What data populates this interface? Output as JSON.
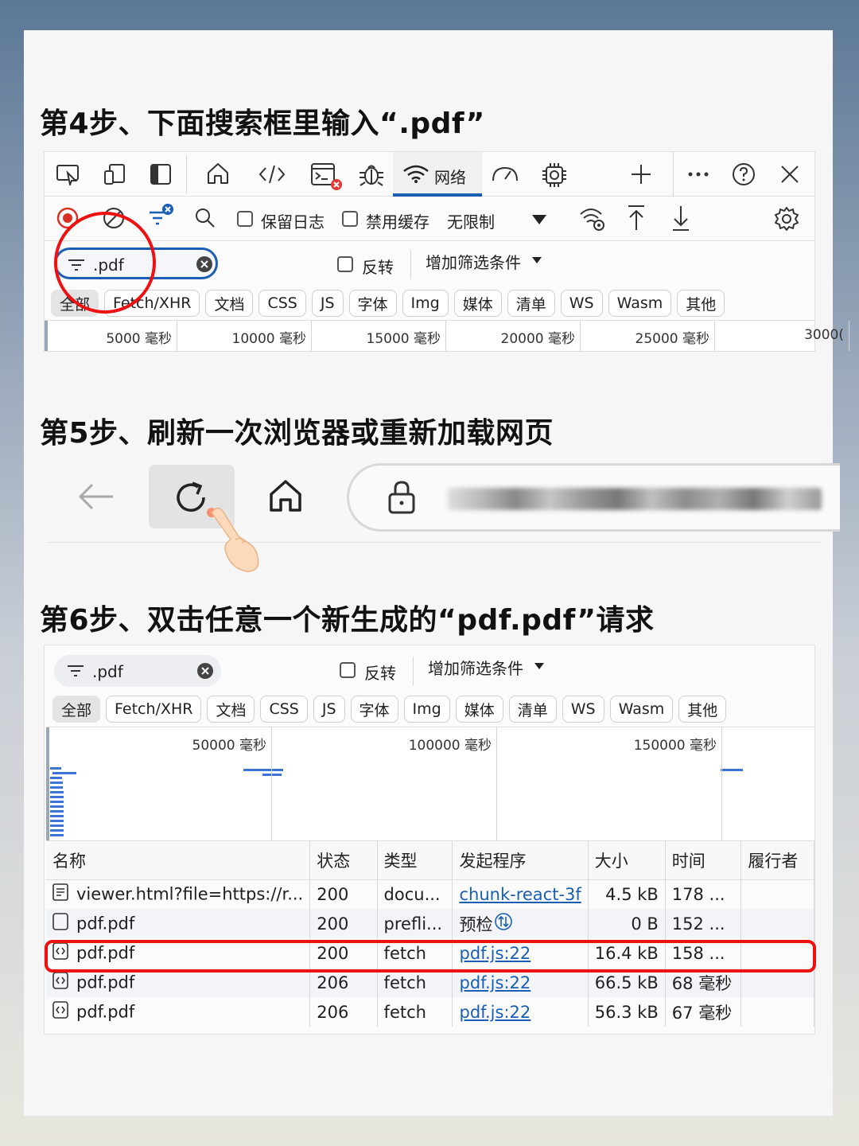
{
  "steps": {
    "step4": "第4步、下面搜索框里输入“.pdf”",
    "step5": "第5步、刷新一次浏览器或重新加载网页",
    "step6": "第6步、双击任意一个新生成的“pdf.pdf”请求"
  },
  "devtools_top": {
    "active_tab_label": "网络",
    "tool_icons": [
      "inspect-icon",
      "device-icon",
      "dock-icon",
      "home-icon",
      "elements-icon",
      "console-icon",
      "bug-icon",
      "wifi-icon",
      "performance-icon",
      "cpu-icon",
      "add-icon",
      "more-icon",
      "help-icon",
      "close-icon"
    ],
    "toolbar": {
      "preserve_log": "保留日志",
      "disable_cache": "禁用缓存",
      "throttle": "无限制"
    },
    "filter": {
      "value": ".pdf",
      "invert": "反转",
      "more_filters": "增加筛选条件"
    },
    "chips": [
      "全部",
      "Fetch/XHR",
      "文档",
      "CSS",
      "JS",
      "字体",
      "Img",
      "媒体",
      "清单",
      "WS",
      "Wasm",
      "其他"
    ],
    "timeline_ticks": [
      "5000 毫秒",
      "10000 毫秒",
      "15000 毫秒",
      "20000 毫秒",
      "25000 毫秒",
      "3000("
    ]
  },
  "browser_bar": {
    "back_icon": "back-arrow-icon",
    "refresh_icon": "refresh-icon",
    "home_icon": "home-icon",
    "lock_icon": "lock-icon"
  },
  "devtools_bottom": {
    "filter": {
      "value": ".pdf",
      "invert": "反转",
      "more_filters": "增加筛选条件"
    },
    "chips": [
      "全部",
      "Fetch/XHR",
      "文档",
      "CSS",
      "JS",
      "字体",
      "Img",
      "媒体",
      "清单",
      "WS",
      "Wasm",
      "其他"
    ],
    "timeline_ticks": [
      "50000 毫秒",
      "100000 毫秒",
      "150000 毫秒"
    ],
    "columns": [
      "名称",
      "状态",
      "类型",
      "发起程序",
      "大小",
      "时间",
      "履行者"
    ],
    "rows": [
      {
        "name": "viewer.html?file=https://r...",
        "status": "200",
        "type": "docu...",
        "initiator": "chunk-react-3f",
        "size": "4.5 kB",
        "time": "178 ...",
        "fulfilled": "",
        "icon": "document-icon",
        "link": true
      },
      {
        "name": "pdf.pdf",
        "status": "200",
        "type": "prefli...",
        "initiator": "预检",
        "size": "0 B",
        "time": "152 ...",
        "fulfilled": "",
        "icon": "blank-file-icon",
        "link": false
      },
      {
        "name": "pdf.pdf",
        "status": "200",
        "type": "fetch",
        "initiator": "pdf.js:22",
        "size": "16.4 kB",
        "time": "158 ...",
        "fulfilled": "",
        "icon": "fetch-icon",
        "link": true
      },
      {
        "name": "pdf.pdf",
        "status": "206",
        "type": "fetch",
        "initiator": "pdf.js:22",
        "size": "66.5 kB",
        "time": "68 毫秒",
        "fulfilled": "",
        "icon": "fetch-icon",
        "link": true
      },
      {
        "name": "pdf.pdf",
        "status": "206",
        "type": "fetch",
        "initiator": "pdf.js:22",
        "size": "56.3 kB",
        "time": "67 毫秒",
        "fulfilled": "",
        "icon": "fetch-icon",
        "link": true
      }
    ]
  },
  "colors": {
    "accent": "#1a5fb4",
    "highlight": "#e11111",
    "record": "#d93025"
  }
}
